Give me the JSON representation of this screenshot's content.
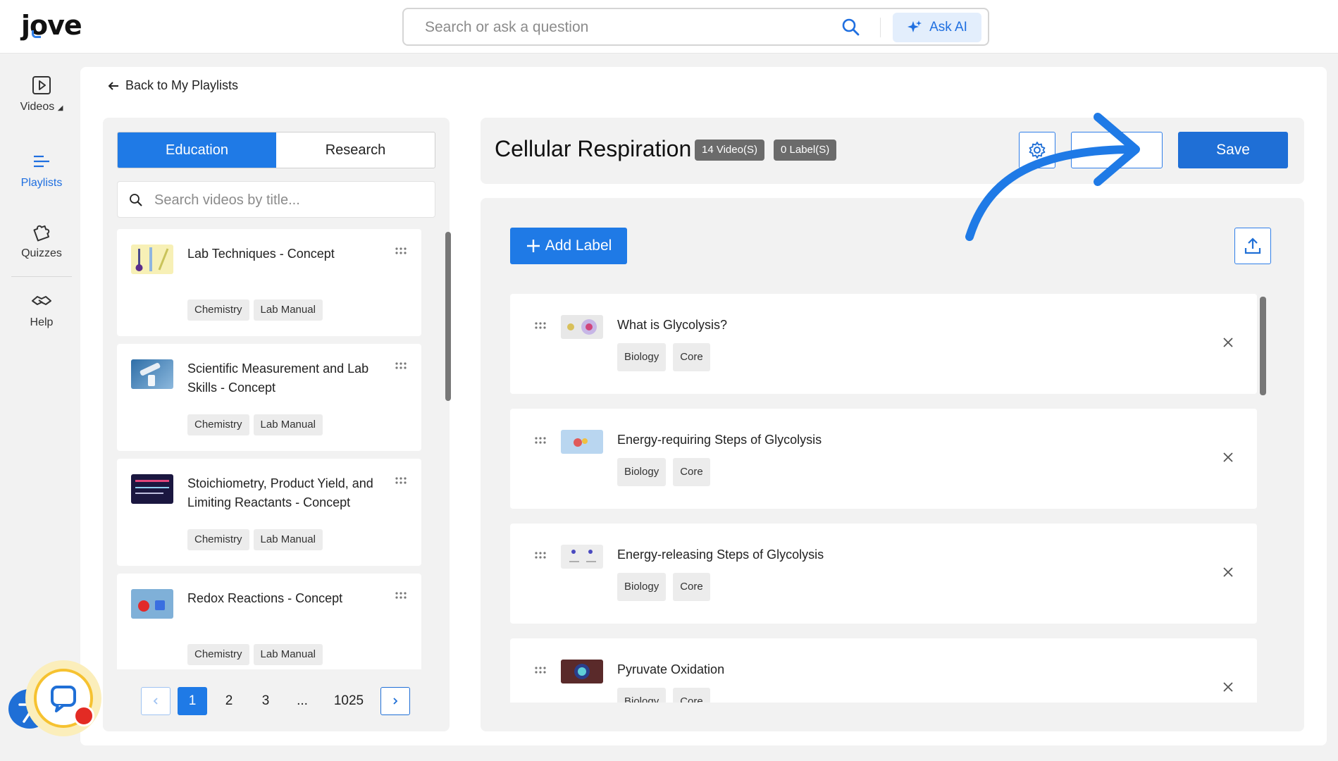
{
  "app": {
    "logo_text": "jove",
    "accent_color": "#1f7ae6"
  },
  "search": {
    "placeholder": "Search or ask a question",
    "ask_ai_label": "Ask AI"
  },
  "rail": {
    "items": [
      {
        "label": "Videos",
        "icon": "play-square-icon"
      },
      {
        "label": "Playlists",
        "icon": "playlist-icon"
      },
      {
        "label": "Quizzes",
        "icon": "puzzle-icon"
      },
      {
        "label": "Help",
        "icon": "handshake-icon"
      }
    ],
    "videos_caret": "◢"
  },
  "back_link": "Back to My Playlists",
  "library": {
    "tabs": [
      "Education",
      "Research"
    ],
    "search_placeholder": "Search videos by title...",
    "items": [
      {
        "title": "Lab Techniques - Concept",
        "tags": [
          "Chemistry",
          "Lab Manual"
        ]
      },
      {
        "title": "Scientific Measurement and Lab Skills - Concept",
        "tags": [
          "Chemistry",
          "Lab Manual"
        ]
      },
      {
        "title": "Stoichiometry, Product Yield, and Limiting Reactants - Concept",
        "tags": [
          "Chemistry",
          "Lab Manual"
        ]
      },
      {
        "title": "Redox Reactions - Concept",
        "tags": [
          "Chemistry",
          "Lab Manual"
        ]
      }
    ],
    "pagination": {
      "pages": [
        "1",
        "2",
        "3",
        "...",
        "1025"
      ],
      "current": "1"
    }
  },
  "playlist": {
    "title": "Cellular Respiration",
    "video_count": "14 Video(S)",
    "label_count": "0 Label(S)",
    "save_label": "Save",
    "add_label": "Add Label",
    "items": [
      {
        "title": "What is Glycolysis?",
        "tags": [
          "Biology",
          "Core"
        ]
      },
      {
        "title": "Energy-requiring Steps of Glycolysis",
        "tags": [
          "Biology",
          "Core"
        ]
      },
      {
        "title": "Energy-releasing Steps of Glycolysis",
        "tags": [
          "Biology",
          "Core"
        ]
      },
      {
        "title": "Pyruvate Oxidation",
        "tags": [
          "Biology",
          "Core"
        ]
      }
    ]
  }
}
